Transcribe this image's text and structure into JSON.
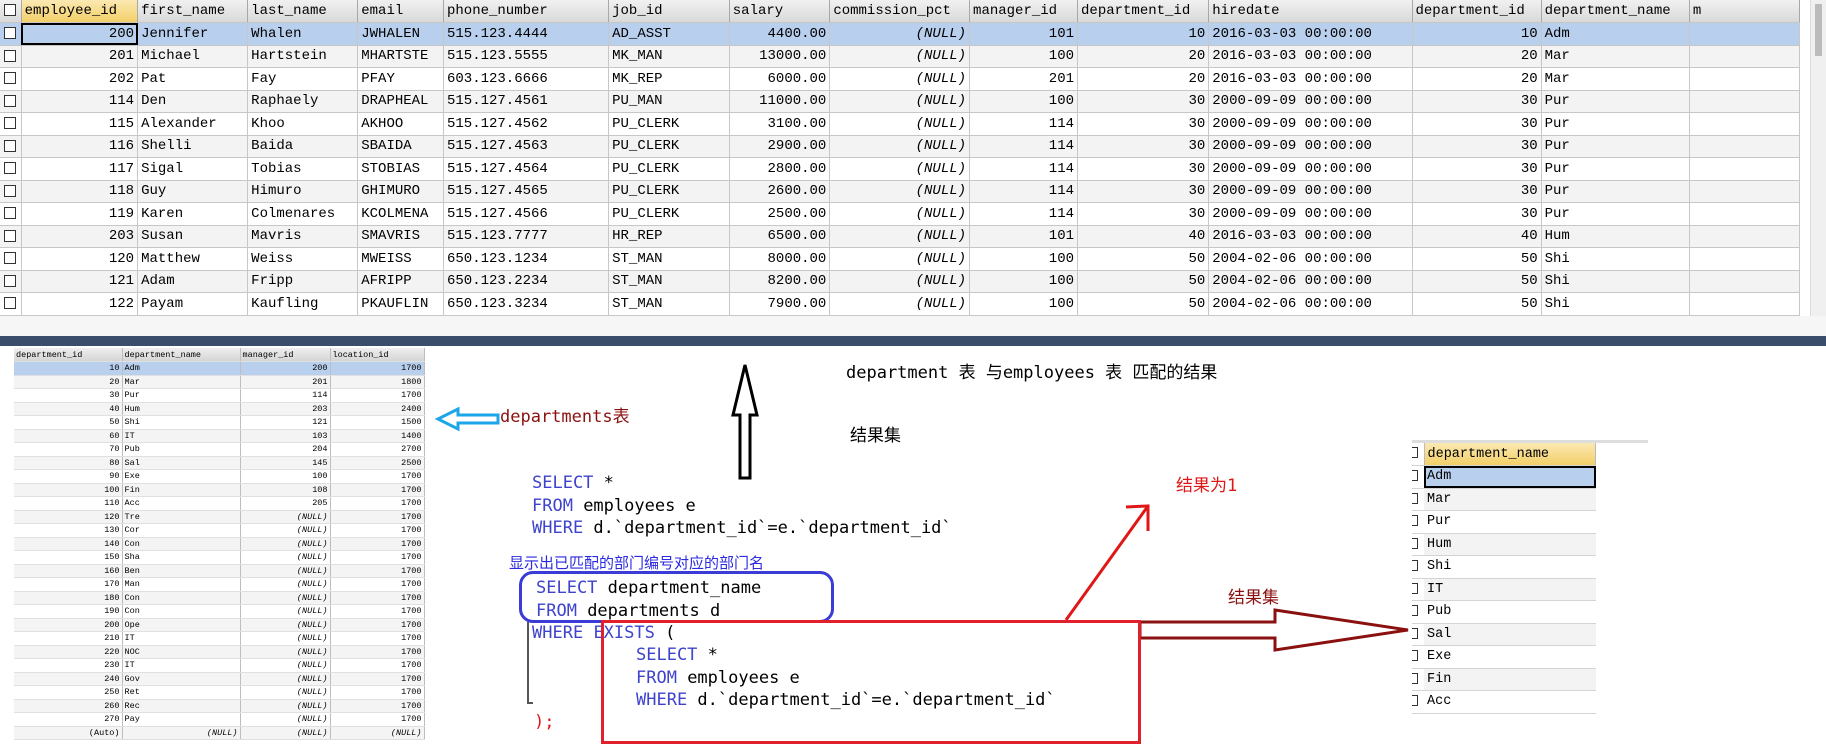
{
  "employees_grid": {
    "columns": [
      "employee_id",
      "first_name",
      "last_name",
      "email",
      "phone_number",
      "job_id",
      "salary",
      "commission_pct",
      "manager_id",
      "department_id",
      "hiredate",
      "department_id",
      "department_name",
      "m"
    ],
    "rows": [
      [
        "200",
        "Jennifer",
        "Whalen",
        "JWHALEN",
        "515.123.4444",
        "AD_ASST",
        "4400.00",
        "(NULL)",
        "101",
        "10",
        "2016-03-03 00:00:00",
        "10",
        "Adm",
        ""
      ],
      [
        "201",
        "Michael",
        "Hartstein",
        "MHARTSTE",
        "515.123.5555",
        "MK_MAN",
        "13000.00",
        "(NULL)",
        "100",
        "20",
        "2016-03-03 00:00:00",
        "20",
        "Mar",
        ""
      ],
      [
        "202",
        "Pat",
        "Fay",
        "PFAY",
        "603.123.6666",
        "MK_REP",
        "6000.00",
        "(NULL)",
        "201",
        "20",
        "2016-03-03 00:00:00",
        "20",
        "Mar",
        ""
      ],
      [
        "114",
        "Den",
        "Raphaely",
        "DRAPHEAL",
        "515.127.4561",
        "PU_MAN",
        "11000.00",
        "(NULL)",
        "100",
        "30",
        "2000-09-09 00:00:00",
        "30",
        "Pur",
        ""
      ],
      [
        "115",
        "Alexander",
        "Khoo",
        "AKHOO",
        "515.127.4562",
        "PU_CLERK",
        "3100.00",
        "(NULL)",
        "114",
        "30",
        "2000-09-09 00:00:00",
        "30",
        "Pur",
        ""
      ],
      [
        "116",
        "Shelli",
        "Baida",
        "SBAIDA",
        "515.127.4563",
        "PU_CLERK",
        "2900.00",
        "(NULL)",
        "114",
        "30",
        "2000-09-09 00:00:00",
        "30",
        "Pur",
        ""
      ],
      [
        "117",
        "Sigal",
        "Tobias",
        "STOBIAS",
        "515.127.4564",
        "PU_CLERK",
        "2800.00",
        "(NULL)",
        "114",
        "30",
        "2000-09-09 00:00:00",
        "30",
        "Pur",
        ""
      ],
      [
        "118",
        "Guy",
        "Himuro",
        "GHIMURO",
        "515.127.4565",
        "PU_CLERK",
        "2600.00",
        "(NULL)",
        "114",
        "30",
        "2000-09-09 00:00:00",
        "30",
        "Pur",
        ""
      ],
      [
        "119",
        "Karen",
        "Colmenares",
        "KCOLMENA",
        "515.127.4566",
        "PU_CLERK",
        "2500.00",
        "(NULL)",
        "114",
        "30",
        "2000-09-09 00:00:00",
        "30",
        "Pur",
        ""
      ],
      [
        "203",
        "Susan",
        "Mavris",
        "SMAVRIS",
        "515.123.7777",
        "HR_REP",
        "6500.00",
        "(NULL)",
        "101",
        "40",
        "2016-03-03 00:00:00",
        "40",
        "Hum",
        ""
      ],
      [
        "120",
        "Matthew",
        "Weiss",
        "MWEISS",
        "650.123.1234",
        "ST_MAN",
        "8000.00",
        "(NULL)",
        "100",
        "50",
        "2004-02-06 00:00:00",
        "50",
        "Shi",
        ""
      ],
      [
        "121",
        "Adam",
        "Fripp",
        "AFRIPP",
        "650.123.2234",
        "ST_MAN",
        "8200.00",
        "(NULL)",
        "100",
        "50",
        "2004-02-06 00:00:00",
        "50",
        "Shi",
        ""
      ],
      [
        "122",
        "Payam",
        "Kaufling",
        "PKAUFLIN",
        "650.123.3234",
        "ST_MAN",
        "7900.00",
        "(NULL)",
        "100",
        "50",
        "2004-02-06 00:00:00",
        "50",
        "Shi",
        ""
      ]
    ]
  },
  "departments_grid": {
    "columns": [
      "department_id",
      "department_name",
      "manager_id",
      "location_id"
    ],
    "rows": [
      [
        "10",
        "Adm",
        "200",
        "1700"
      ],
      [
        "20",
        "Mar",
        "201",
        "1800"
      ],
      [
        "30",
        "Pur",
        "114",
        "1700"
      ],
      [
        "40",
        "Hum",
        "203",
        "2400"
      ],
      [
        "50",
        "Shi",
        "121",
        "1500"
      ],
      [
        "60",
        "IT",
        "103",
        "1400"
      ],
      [
        "70",
        "Pub",
        "204",
        "2700"
      ],
      [
        "80",
        "Sal",
        "145",
        "2500"
      ],
      [
        "90",
        "Exe",
        "100",
        "1700"
      ],
      [
        "100",
        "Fin",
        "108",
        "1700"
      ],
      [
        "110",
        "Acc",
        "205",
        "1700"
      ],
      [
        "120",
        "Tre",
        "(NULL)",
        "1700"
      ],
      [
        "130",
        "Cor",
        "(NULL)",
        "1700"
      ],
      [
        "140",
        "Con",
        "(NULL)",
        "1700"
      ],
      [
        "150",
        "Sha",
        "(NULL)",
        "1700"
      ],
      [
        "160",
        "Ben",
        "(NULL)",
        "1700"
      ],
      [
        "170",
        "Man",
        "(NULL)",
        "1700"
      ],
      [
        "180",
        "Con",
        "(NULL)",
        "1700"
      ],
      [
        "190",
        "Con",
        "(NULL)",
        "1700"
      ],
      [
        "200",
        "Ope",
        "(NULL)",
        "1700"
      ],
      [
        "210",
        "IT",
        "(NULL)",
        "1700"
      ],
      [
        "220",
        "NOC",
        "(NULL)",
        "1700"
      ],
      [
        "230",
        "IT",
        "(NULL)",
        "1700"
      ],
      [
        "240",
        "Gov",
        "(NULL)",
        "1700"
      ],
      [
        "250",
        "Ret",
        "(NULL)",
        "1700"
      ],
      [
        "260",
        "Rec",
        "(NULL)",
        "1700"
      ],
      [
        "270",
        "Pay",
        "(NULL)",
        "1700"
      ],
      [
        "(Auto)",
        "(NULL)",
        "(NULL)",
        "(NULL)"
      ]
    ]
  },
  "result_grid": {
    "column": "department_name",
    "rows": [
      "Adm",
      "Mar",
      "Pur",
      "Hum",
      "Shi",
      "IT",
      "Pub",
      "Sal",
      "Exe",
      "Fin",
      "Acc"
    ]
  },
  "annotations": {
    "title": "department 表 与employees 表 匹配的结果",
    "departments_label": "departments表",
    "result_set_1": "结果集",
    "result_is_one": "结果为1",
    "result_set_2": "结果集",
    "caption": "显示出已匹配的部门编号对应的部门名"
  },
  "code": {
    "line1_kw": "SELECT",
    "line1_rest": " *",
    "line2_kw": "FROM",
    "line2_rest": " employees e",
    "line3_kw": "WHERE",
    "line3_rest": " d.`department_id`=e.`department_id`",
    "line4_kw": "SELECT",
    "line4_rest": " department_name",
    "line5_kw": "FROM",
    "line5_rest": " departments d",
    "line6_kw1": "WHERE",
    "line6_kw2": "EXISTS",
    "line6_rest": " (",
    "line7_kw": "SELECT",
    "line7_rest": " *",
    "line8_kw": "FROM",
    "line8_rest": " employees e",
    "line9_kw": "WHERE",
    "line9_rest": " d.`department_id`=e.`department_id`",
    "line10": ");"
  },
  "colors": {
    "keyword": "#3e43cc",
    "red_annotation": "#e01717",
    "dark_red_arrow": "#8b1111",
    "blue_arrow": "#1aa6e8",
    "selected_row": "#b9cfee",
    "sorted_header": "#f2cf68"
  }
}
